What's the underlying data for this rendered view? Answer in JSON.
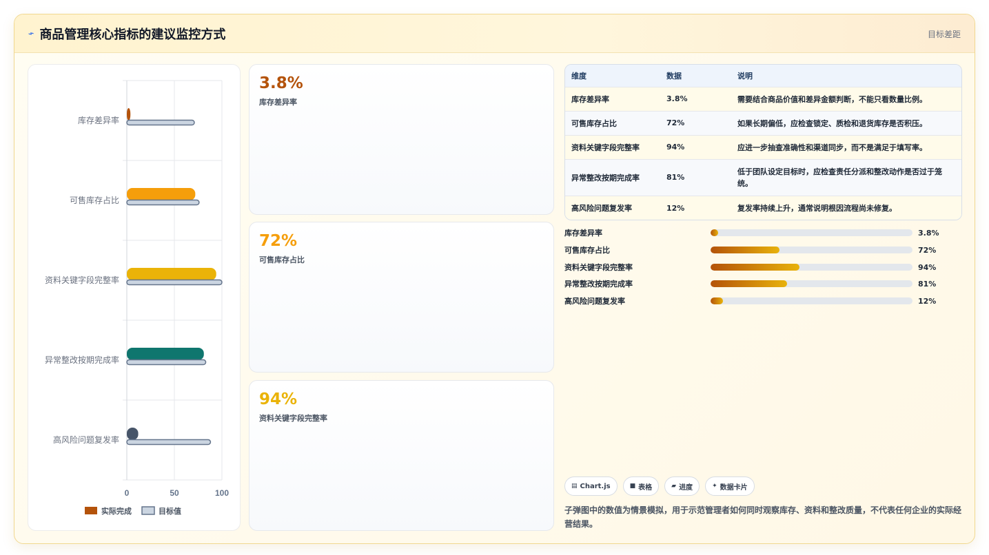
{
  "header": {
    "icon": "line-chart-icon",
    "title": "商品管理核心指标的建议监控方式",
    "tag": "目标差距"
  },
  "chart_data": {
    "type": "bar",
    "orientation": "horizontal",
    "categories": [
      "库存差异率",
      "可售库存占比",
      "资料关键字段完整率",
      "异常整改按期完成率",
      "高风险问题复发率"
    ],
    "series": [
      {
        "name": "实际完成",
        "values": [
          3.8,
          72,
          94,
          81,
          12
        ],
        "colors": [
          "#b4530b",
          "#f59e0b",
          "#eab308",
          "#0f766e",
          "#475569"
        ]
      },
      {
        "name": "目标值",
        "values": [
          71,
          76,
          100,
          83,
          88
        ],
        "color": "#cbd5e1",
        "stroke": "#64748b"
      }
    ],
    "xlim": [
      0,
      100
    ],
    "xticks": [
      "0",
      "50",
      "100"
    ],
    "grid": true,
    "legend": "bottom"
  },
  "kpis": [
    {
      "value": "3.8%",
      "label": "库存差异率",
      "color": "#b4530b"
    },
    {
      "value": "72%",
      "label": "可售库存占比",
      "color": "#f59e0b"
    },
    {
      "value": "94%",
      "label": "资料关键字段完整率",
      "color": "#eab308"
    }
  ],
  "table": {
    "headers": [
      "维度",
      "数据",
      "说明"
    ],
    "rows": [
      [
        "库存差异率",
        "3.8%",
        "需要结合商品价值和差异金额判断，不能只看数量比例。"
      ],
      [
        "可售库存占比",
        "72%",
        "如果长期偏低，应检查锁定、质检和退货库存是否积压。"
      ],
      [
        "资料关键字段完整率",
        "94%",
        "应进一步抽查准确性和渠道同步，而不是满足于填写率。"
      ],
      [
        "异常整改按期完成率",
        "81%",
        "低于团队设定目标时，应检查责任分派和整改动作是否过于笼统。"
      ],
      [
        "高风险问题复发率",
        "12%",
        "复发率持续上升，通常说明根因流程尚未修复。"
      ]
    ]
  },
  "progress": [
    {
      "label": "库存差异率",
      "value": "3.8%",
      "fill": 0.038
    },
    {
      "label": "可售库存占比",
      "value": "72%",
      "fill": 0.34
    },
    {
      "label": "资料关键字段完整率",
      "value": "94%",
      "fill": 0.44
    },
    {
      "label": "异常整改按期完成率",
      "value": "81%",
      "fill": 0.38
    },
    {
      "label": "高风险问题复发率",
      "value": "12%",
      "fill": 0.06
    }
  ],
  "chips": [
    {
      "icon": "chart-icon",
      "glyph": "▤",
      "label": "Chart.js"
    },
    {
      "icon": "table-icon",
      "glyph": "■",
      "label": "表格"
    },
    {
      "icon": "progress-icon",
      "glyph": "▰",
      "label": "进度"
    },
    {
      "icon": "sparkle-icon",
      "glyph": "✦",
      "label": "数据卡片"
    }
  ],
  "note": "子弹图中的数值为情景模拟，用于示范管理者如何同时观察库存、资料和整改质量，不代表任何企业的实际经营结果。"
}
